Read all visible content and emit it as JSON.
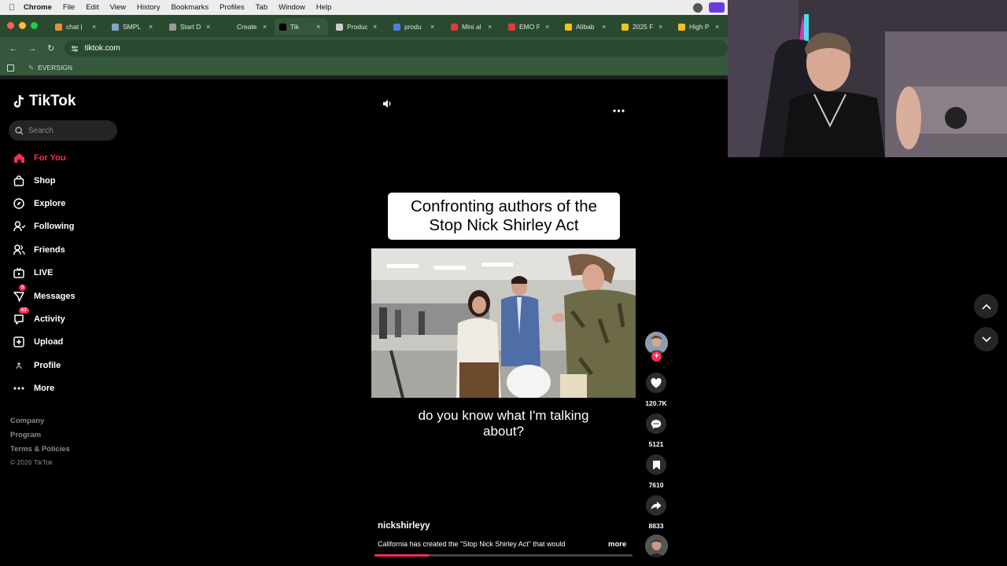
{
  "menubar": {
    "app": "Chrome",
    "items": [
      "File",
      "Edit",
      "View",
      "History",
      "Bookmarks",
      "Profiles",
      "Tab",
      "Window",
      "Help"
    ]
  },
  "tabs": [
    {
      "title": "chat | ",
      "color": "#f08b3a"
    },
    {
      "title": "SMPL",
      "color": "#7fa6c9"
    },
    {
      "title": "Start D",
      "color": "#9a9a9a"
    },
    {
      "title": "Create",
      "color": "#2a4a30"
    },
    {
      "title": "Tik",
      "color": "#000000",
      "active": true
    },
    {
      "title": "Produc",
      "color": "#cccccc"
    },
    {
      "title": "produ",
      "color": "#4a7ee8"
    },
    {
      "title": "Mini al",
      "color": "#e03b3b"
    },
    {
      "title": "EMO P",
      "color": "#e03b3b"
    },
    {
      "title": "Alibab",
      "color": "#f0c419"
    },
    {
      "title": "2025 F",
      "color": "#f0c419"
    },
    {
      "title": "High P",
      "color": "#f0c419"
    }
  ],
  "address": {
    "url": "tiktok.com"
  },
  "bookmarks": {
    "items": [
      "EVERSIGN"
    ]
  },
  "sidebar": {
    "logo": "TikTok",
    "search_placeholder": "Search",
    "nav": [
      {
        "label": "For You",
        "icon": "home-icon",
        "active": true
      },
      {
        "label": "Shop",
        "icon": "shop-bag-icon"
      },
      {
        "label": "Explore",
        "icon": "compass-icon"
      },
      {
        "label": "Following",
        "icon": "following-icon"
      },
      {
        "label": "Friends",
        "icon": "friends-icon"
      },
      {
        "label": "LIVE",
        "icon": "live-tv-icon"
      },
      {
        "label": "Messages",
        "icon": "send-icon",
        "badge": "5"
      },
      {
        "label": "Activity",
        "icon": "activity-icon",
        "badge": "63"
      },
      {
        "label": "Upload",
        "icon": "plus-square-icon"
      },
      {
        "label": "Profile",
        "icon": "profile-icon"
      },
      {
        "label": "More",
        "icon": "more-dots-icon"
      }
    ],
    "footer": [
      "Company",
      "Program",
      "Terms & Policies"
    ],
    "copyright": "© 2026 TikTok"
  },
  "video": {
    "title_line1": "Confronting authors of the",
    "title_line2": "Stop Nick Shirley Act",
    "caption_line1": "do you know what I'm talking",
    "caption_line2": "about?",
    "author": "nickshirleyy",
    "description": "California has created the \"Stop Nick Shirley Act\" that would",
    "more": "more",
    "progress": 0.21
  },
  "actions": {
    "likes": "120.7K",
    "comments": "5121",
    "saves": "7610",
    "shares": "8833"
  },
  "colors": {
    "accent": "#fe2c55",
    "chrome_frame": "#35573b"
  }
}
